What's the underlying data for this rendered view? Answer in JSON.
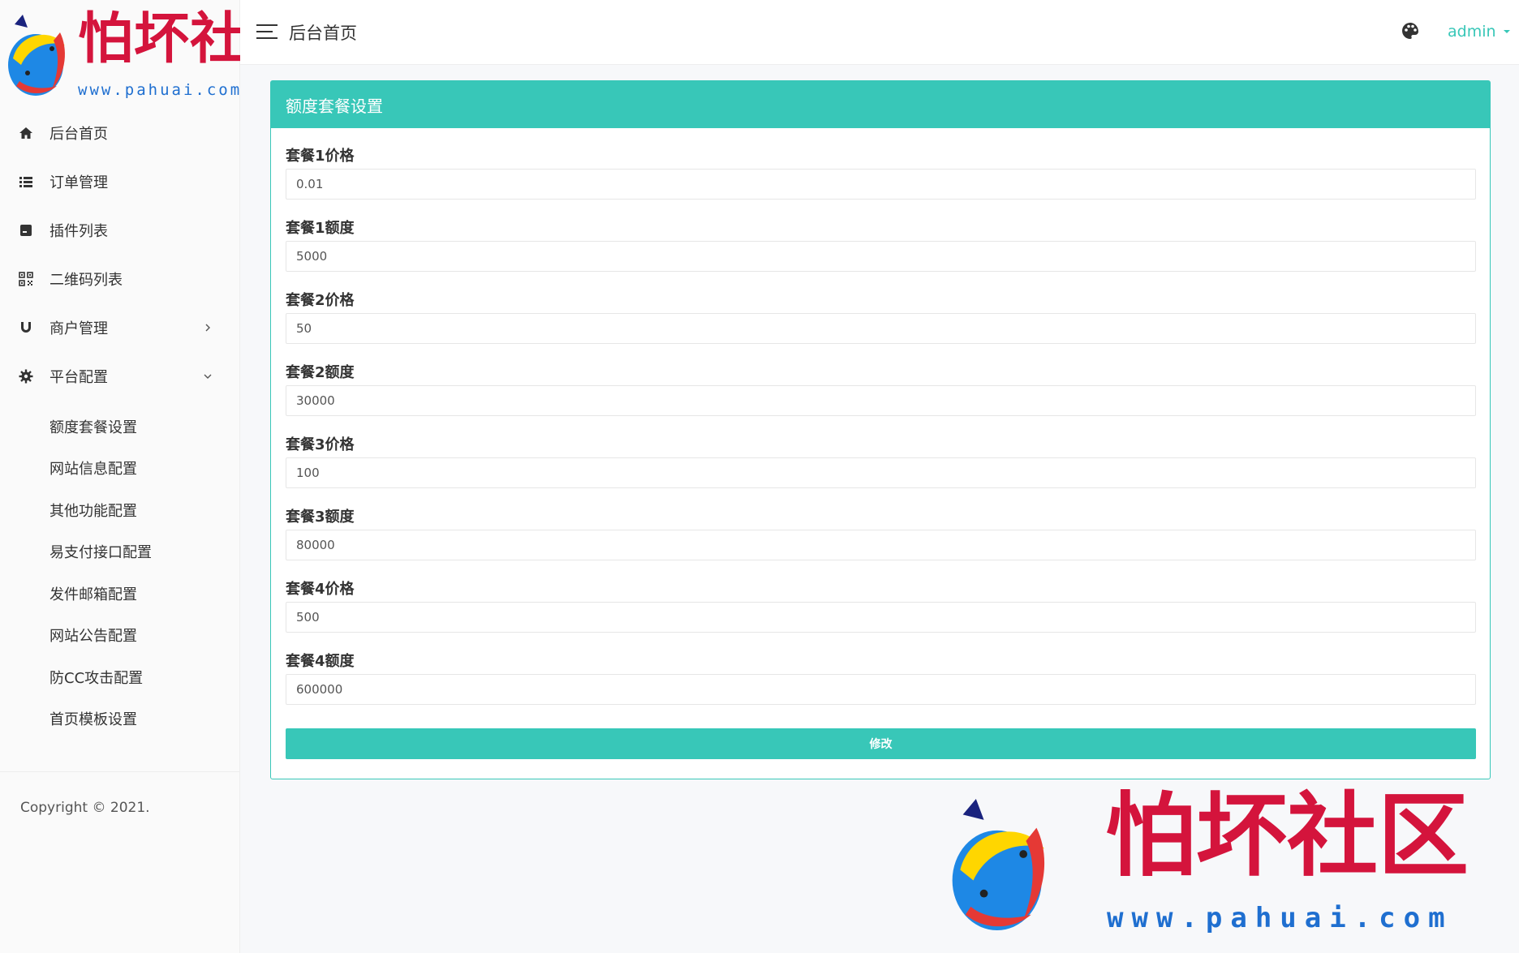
{
  "brand": {
    "name": "怕坏社区",
    "url": "www.pahuai.com"
  },
  "topbar": {
    "title": "后台首页",
    "user": "admin",
    "menu_icon": "hamburger-icon",
    "theme_icon": "palette-icon"
  },
  "sidebar": {
    "items": [
      {
        "label": "后台首页",
        "icon": "home-icon"
      },
      {
        "label": "订单管理",
        "icon": "list-icon"
      },
      {
        "label": "插件列表",
        "icon": "plugin-icon"
      },
      {
        "label": "二维码列表",
        "icon": "qrcode-icon"
      },
      {
        "label": "商户管理",
        "icon": "magnet-icon",
        "arrow": "chevron-right-icon"
      },
      {
        "label": "平台配置",
        "icon": "gear-icon",
        "arrow": "chevron-down-icon"
      }
    ],
    "subitems": [
      "额度套餐设置",
      "网站信息配置",
      "其他功能配置",
      "易支付接口配置",
      "发件邮箱配置",
      "网站公告配置",
      "防CC攻击配置",
      "首页模板设置"
    ],
    "copyright": "Copyright © 2021."
  },
  "card": {
    "title": "额度套餐设置",
    "fields": [
      {
        "label": "套餐1价格",
        "value": "0.01"
      },
      {
        "label": "套餐1额度",
        "value": "5000"
      },
      {
        "label": "套餐2价格",
        "value": "50"
      },
      {
        "label": "套餐2额度",
        "value": "30000"
      },
      {
        "label": "套餐3价格",
        "value": "100"
      },
      {
        "label": "套餐3额度",
        "value": "80000"
      },
      {
        "label": "套餐4价格",
        "value": "500"
      },
      {
        "label": "套餐4额度",
        "value": "600000"
      }
    ],
    "submit_label": "修改"
  },
  "colors": {
    "accent": "#38c7b8",
    "brand_red": "#d4143c",
    "brand_blue": "#1f6fd0"
  }
}
